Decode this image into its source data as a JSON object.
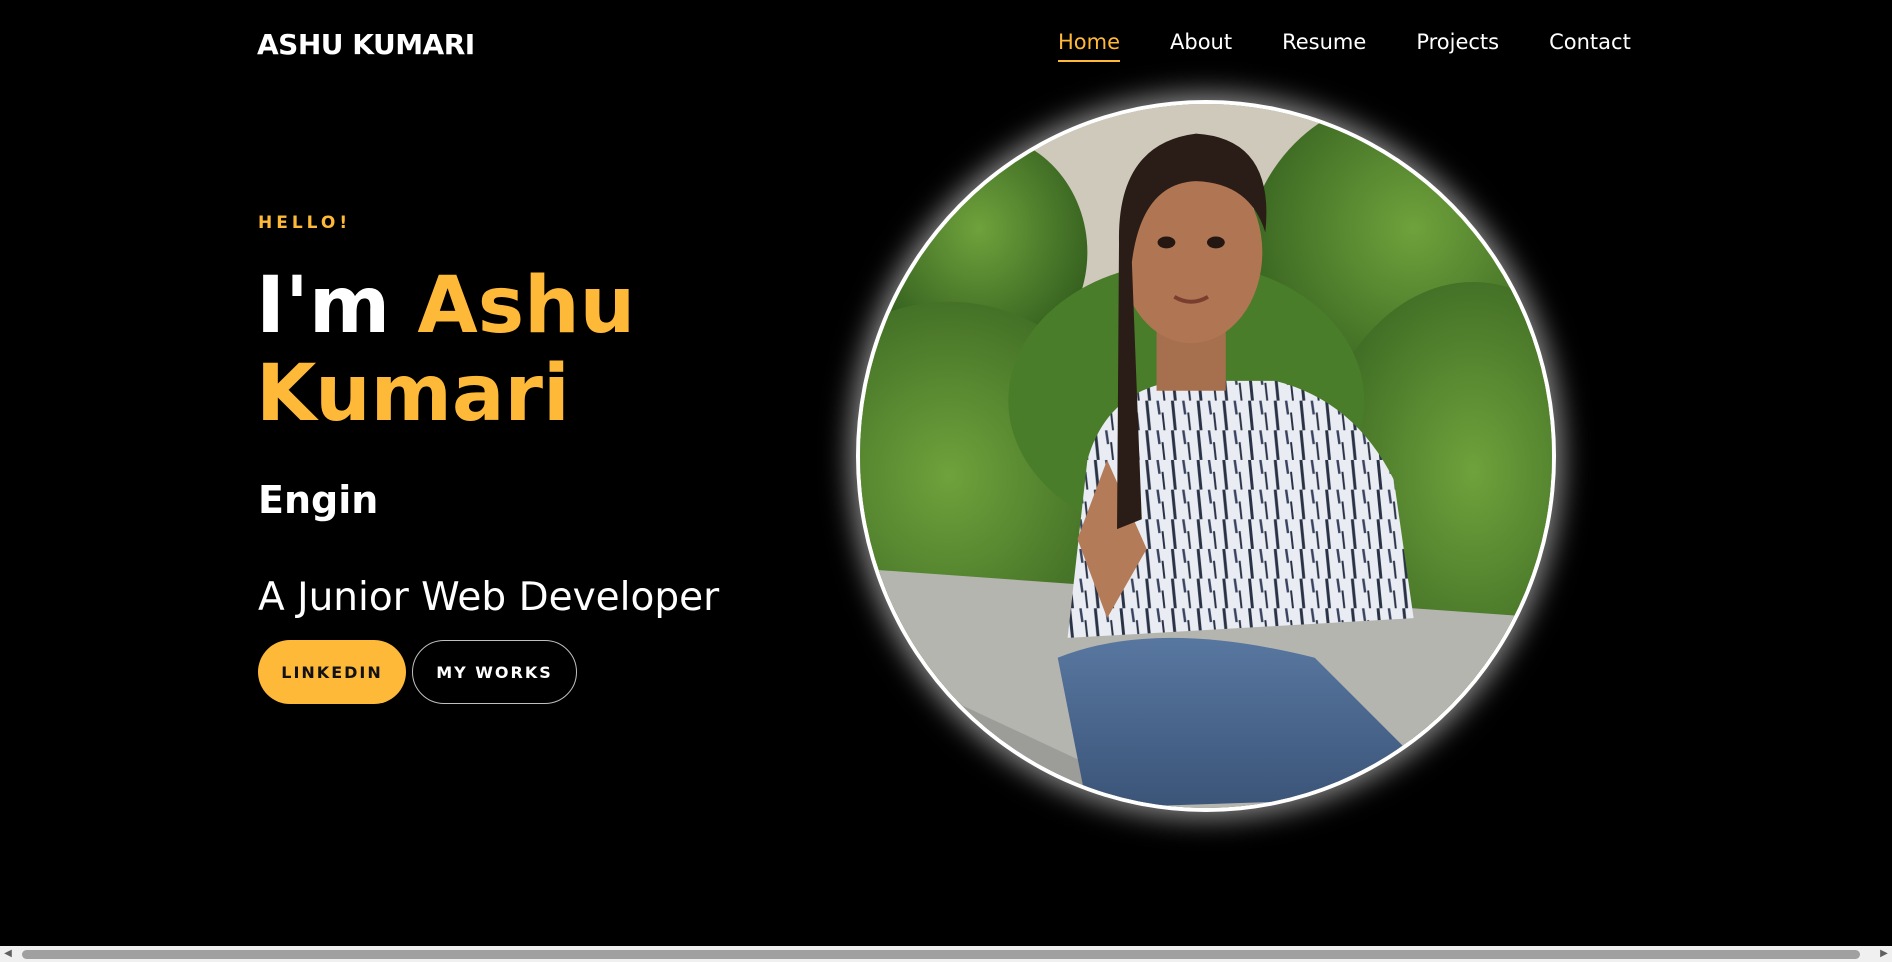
{
  "header": {
    "brand": "ASHU KUMARI",
    "nav": [
      {
        "label": "Home",
        "active": true
      },
      {
        "label": "About",
        "active": false
      },
      {
        "label": "Resume",
        "active": false
      },
      {
        "label": "Projects",
        "active": false
      },
      {
        "label": "Contact",
        "active": false
      }
    ]
  },
  "hero": {
    "greeting": "HELLO!",
    "headline_prefix": "I'm",
    "headline_first": "Ashu",
    "headline_last": "Kumari",
    "typed_text": "Engin",
    "role": "A Junior Web Developer",
    "buttons": {
      "primary": "LINKEDIN",
      "secondary": "MY WORKS"
    }
  },
  "portrait": {
    "subject": "profile-photo"
  },
  "colors": {
    "accent": "#ffb938",
    "background": "#000000",
    "text": "#ffffff"
  },
  "scrollbar": {
    "left_icon": "arrow-left-icon",
    "right_icon": "arrow-right-icon"
  }
}
